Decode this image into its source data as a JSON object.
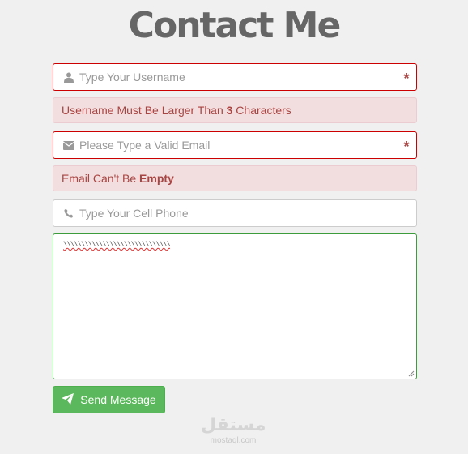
{
  "header": {
    "title": "Contact Me"
  },
  "form": {
    "username": {
      "placeholder": "Type Your Username",
      "value": "",
      "required_mark": "*",
      "icon": "user-icon"
    },
    "username_error": {
      "prefix": "Username Must Be Larger Than ",
      "count": "3",
      "suffix": " Characters"
    },
    "email": {
      "placeholder": "Please Type a Valid Email",
      "value": "",
      "required_mark": "*",
      "icon": "envelope-icon"
    },
    "email_error": {
      "prefix": "Email Can't Be ",
      "emphasis": "Empty"
    },
    "phone": {
      "placeholder": "Type Your Cell Phone",
      "value": "",
      "icon": "phone-icon"
    },
    "message": {
      "value": "\\\\\\\\\\\\\\\\\\\\\\\\\\\\\\\\\\\\\\\\\\\\\\\\\\\\\\\\\\\\"
    },
    "send_label": "Send Message",
    "send_icon": "paper-plane-icon"
  },
  "colors": {
    "error_text": "#a94442",
    "error_bg": "#f2dede",
    "invalid_border": "#cc0000",
    "valid_border": "#3c9c3c",
    "button_bg": "#5cb85c"
  },
  "watermark": {
    "logo": "مستقل",
    "url": "mostaql.com"
  }
}
